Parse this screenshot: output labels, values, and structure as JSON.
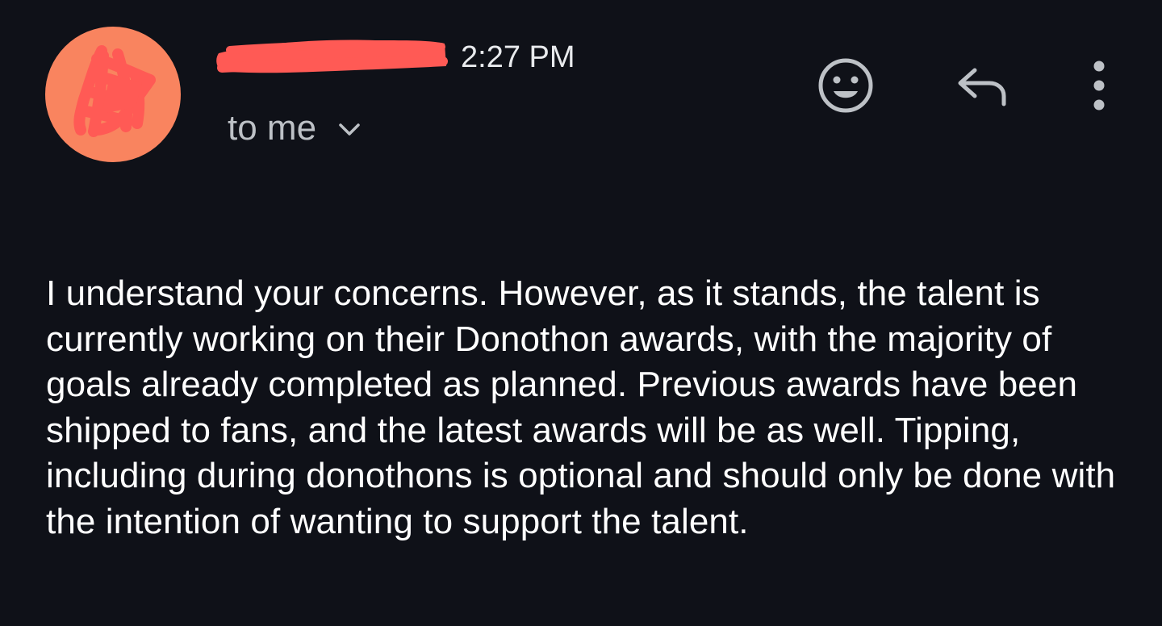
{
  "header": {
    "time": "2:27 PM",
    "recipient": "to me"
  },
  "icons": {
    "emoji": "add-reaction-icon",
    "reply": "reply-icon",
    "more": "more-vertical-icon",
    "chevron": "chevron-down-icon"
  },
  "colors": {
    "background": "#0f1118",
    "avatar": "#f9845f",
    "redaction": "#ff5a55",
    "text": "#ffffff",
    "secondary_text": "#bdc1c6"
  },
  "message": {
    "body": "I understand your concerns. However, as it stands, the talent is currently working on their Donothon awards, with the majority of goals already completed as planned. Previous awards have been shipped to fans, and the latest awards will be as well. Tipping, including during donothons is optional and should only be done with the intention of wanting to support the talent."
  }
}
